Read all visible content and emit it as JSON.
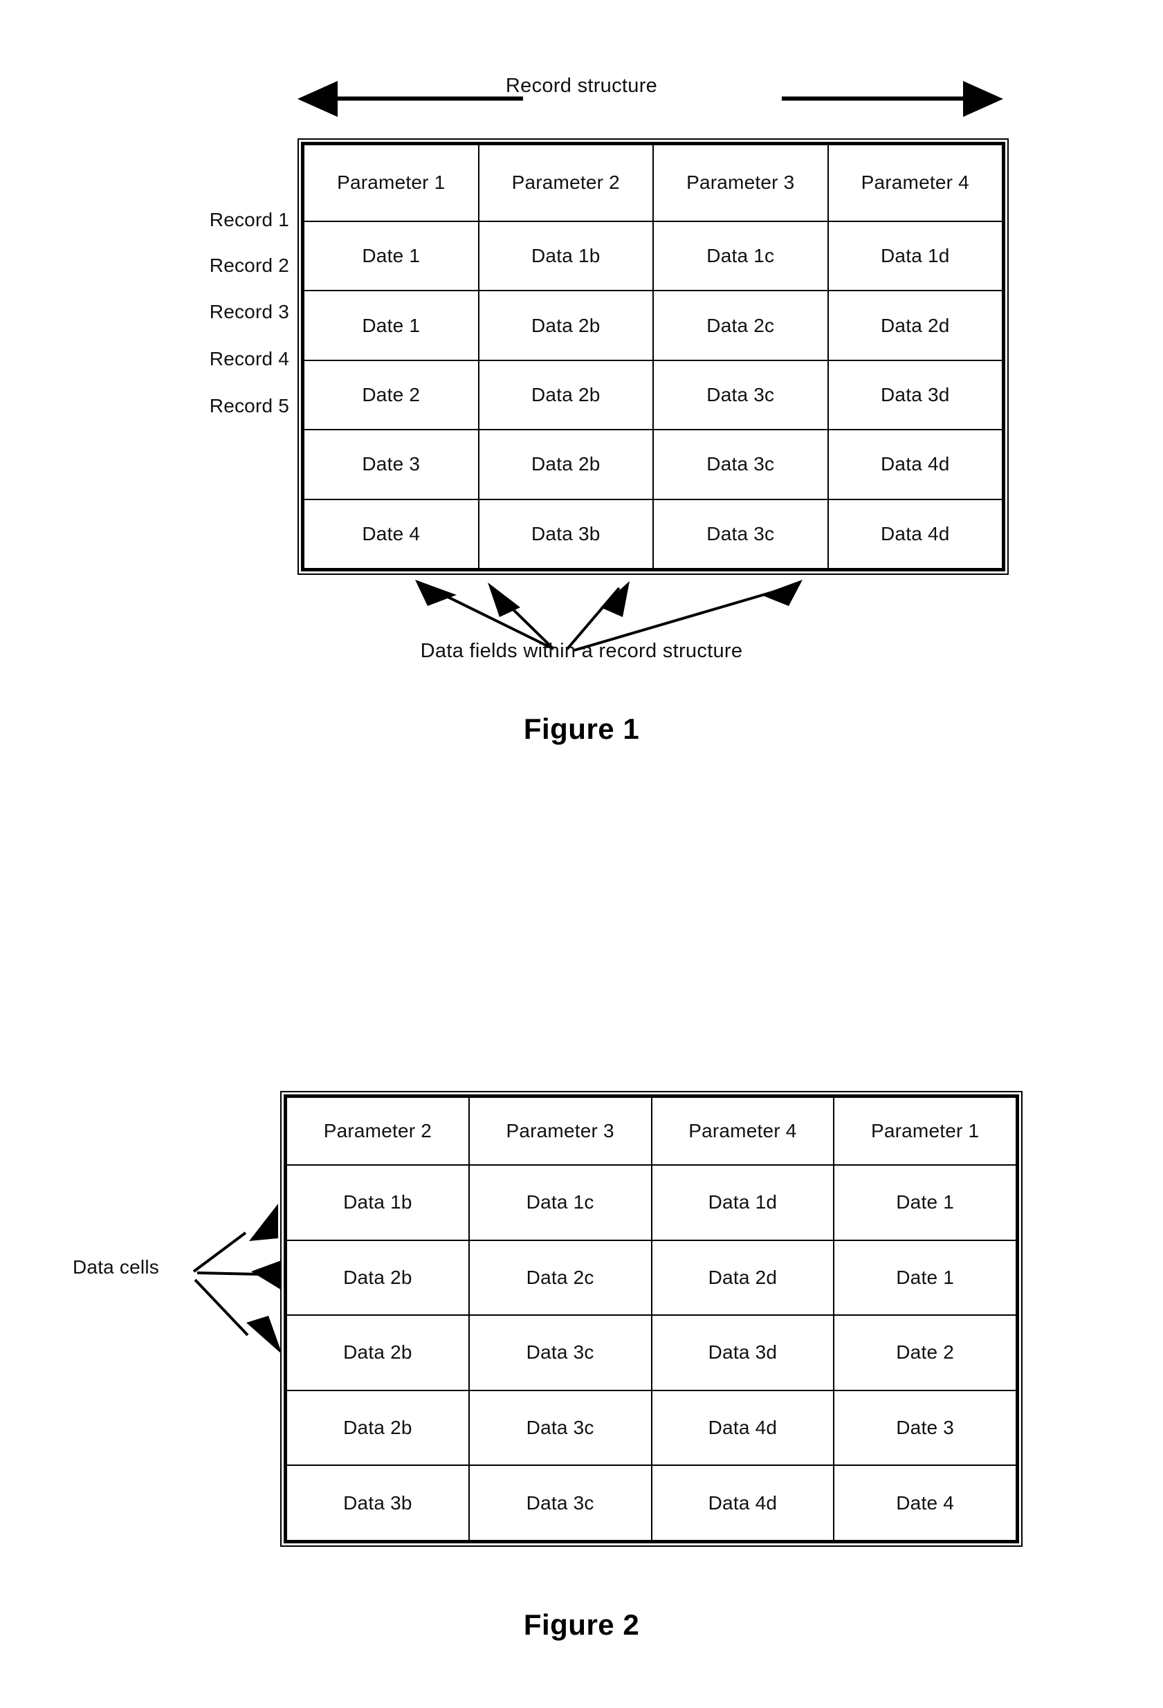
{
  "document": {
    "type": "patent-figure-sheet"
  },
  "figure1": {
    "caption": "Figure 1",
    "top_annotation": "Record structure",
    "bottom_annotation": "Data fields within a record structure",
    "column_headers": [
      "Parameter 1",
      "Parameter 2",
      "Parameter 3",
      "Parameter 4"
    ],
    "row_labels": [
      "Record 1",
      "Record 2",
      "Record 3",
      "Record 4",
      "Record 5"
    ],
    "rows": [
      [
        "Date 1",
        "Data 1b",
        "Data 1c",
        "Data 1d"
      ],
      [
        "Date 1",
        "Data 2b",
        "Data 2c",
        "Data 2d"
      ],
      [
        "Date 2",
        "Data 2b",
        "Data 3c",
        "Data 3d"
      ],
      [
        "Date 3",
        "Data 2b",
        "Data 3c",
        "Data 4d"
      ],
      [
        "Date 4",
        "Data 3b",
        "Data 3c",
        "Data 4d"
      ]
    ],
    "arrow_count_bottom": 4
  },
  "figure2": {
    "caption": "Figure 2",
    "side_annotation": "Data cells",
    "column_headers": [
      "Parameter 2",
      "Parameter 3",
      "Parameter 4",
      "Parameter 1"
    ],
    "rows": [
      [
        "Data 1b",
        "Data 1c",
        "Data 1d",
        "Date 1"
      ],
      [
        "Data 2b",
        "Data 2c",
        "Data 2d",
        "Date 1"
      ],
      [
        "Data 2b",
        "Data 3c",
        "Data 3d",
        "Date 2"
      ],
      [
        "Data 2b",
        "Data 3c",
        "Data 4d",
        "Date 3"
      ],
      [
        "Data 3b",
        "Data 3c",
        "Data 4d",
        "Date 4"
      ]
    ],
    "arrow_count_side": 3
  },
  "colors": {
    "ink": "#000000",
    "paper": "#ffffff",
    "text": "#111111"
  }
}
